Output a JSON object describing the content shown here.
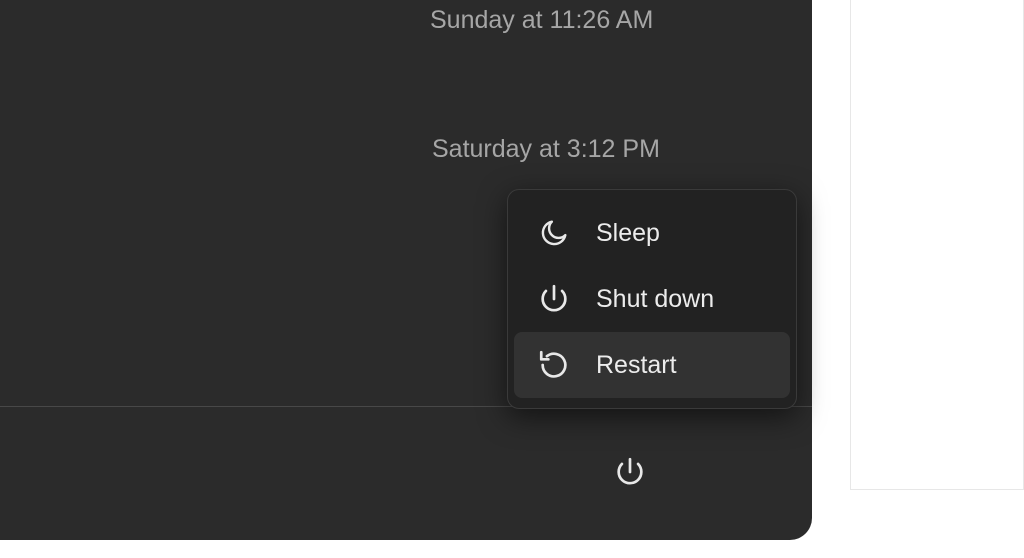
{
  "timestamps": {
    "first": "Sunday at 11:26 AM",
    "second": "Saturday at 3:12 PM"
  },
  "power_menu": {
    "sleep_label": "Sleep",
    "shutdown_label": "Shut down",
    "restart_label": "Restart"
  },
  "icons": {
    "sleep": "moon-icon",
    "shutdown": "power-icon",
    "restart": "restart-icon",
    "power_button": "power-icon"
  }
}
